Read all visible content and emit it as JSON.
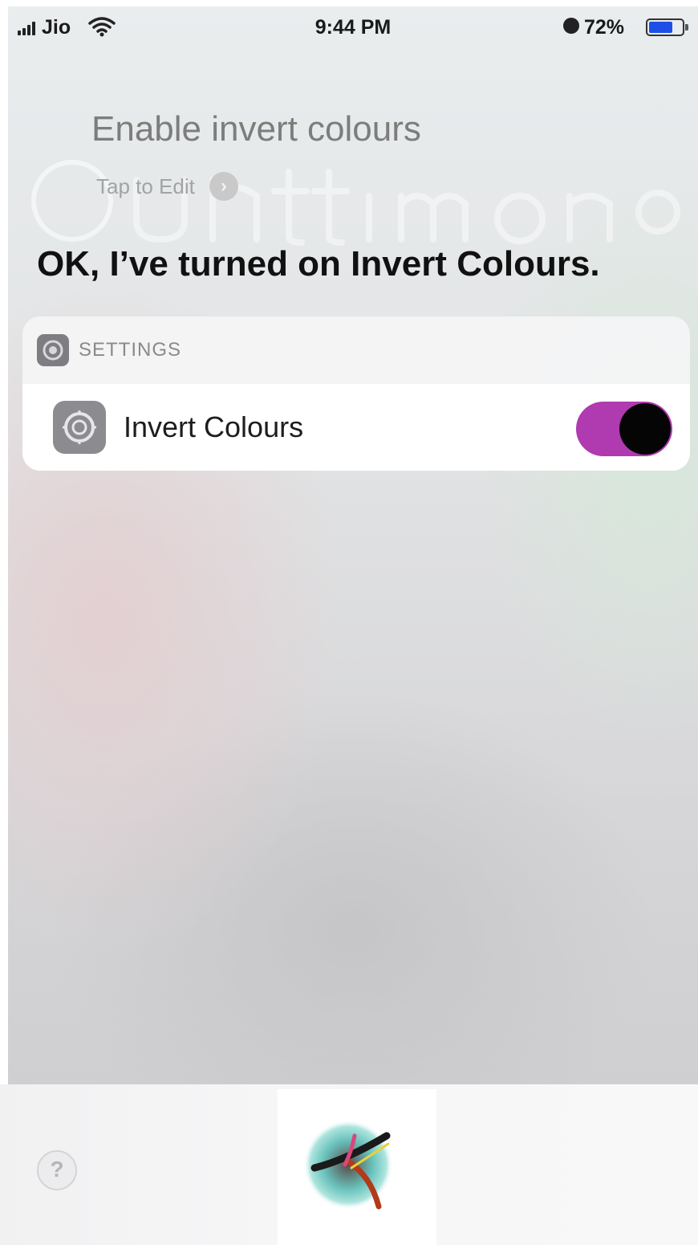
{
  "status_bar": {
    "carrier": "Jio",
    "time": "9:44 PM",
    "battery_percent": "72%",
    "battery_level": 0.72,
    "icons": [
      "signal-icon",
      "wifi-icon",
      "alarm-icon",
      "battery-icon"
    ]
  },
  "siri": {
    "query": "Enable invert colours",
    "tap_to_edit": "Tap to Edit",
    "response": "OK, I’ve turned on Invert Colours."
  },
  "settings_card": {
    "app_name": "SETTINGS",
    "row_label": "Invert Colours",
    "toggle_on": true,
    "toggle_color": "#b03ab0"
  },
  "bottom": {
    "help_label": "?"
  },
  "colors": {
    "battery_fill": "#1d4ee8",
    "toggle_on": "#b03ab0"
  }
}
